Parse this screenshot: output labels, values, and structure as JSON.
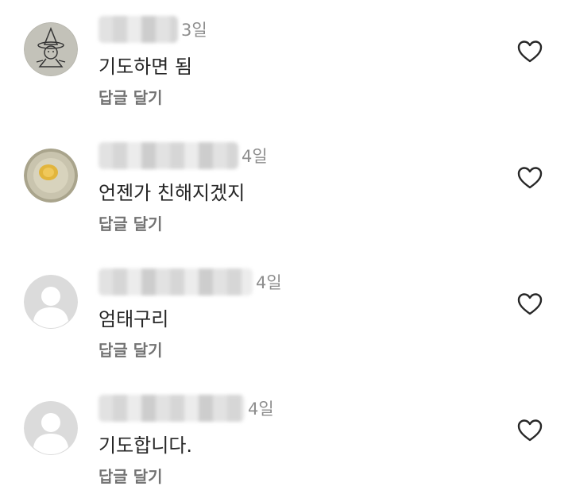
{
  "comments": [
    {
      "time": "3일",
      "text": "기도하면 됨",
      "reply_label": "답글 달기",
      "avatar": "witch-drawing-avatar"
    },
    {
      "time": "4일",
      "text": "언젠가 친해지겠지",
      "reply_label": "답글 달기",
      "avatar": "yellow-circle-avatar"
    },
    {
      "time": "4일",
      "text": "엄태구리",
      "reply_label": "답글 달기",
      "avatar": "default-avatar"
    },
    {
      "time": "4일",
      "text": "기도합니다.",
      "reply_label": "답글 달기",
      "avatar": "default-avatar"
    }
  ],
  "icons": {
    "like": "heart-outline-icon"
  },
  "colors": {
    "text": "#262626",
    "secondary": "#8e8e8e",
    "reply": "#737373",
    "default_avatar_bg": "#dbdbdb"
  }
}
